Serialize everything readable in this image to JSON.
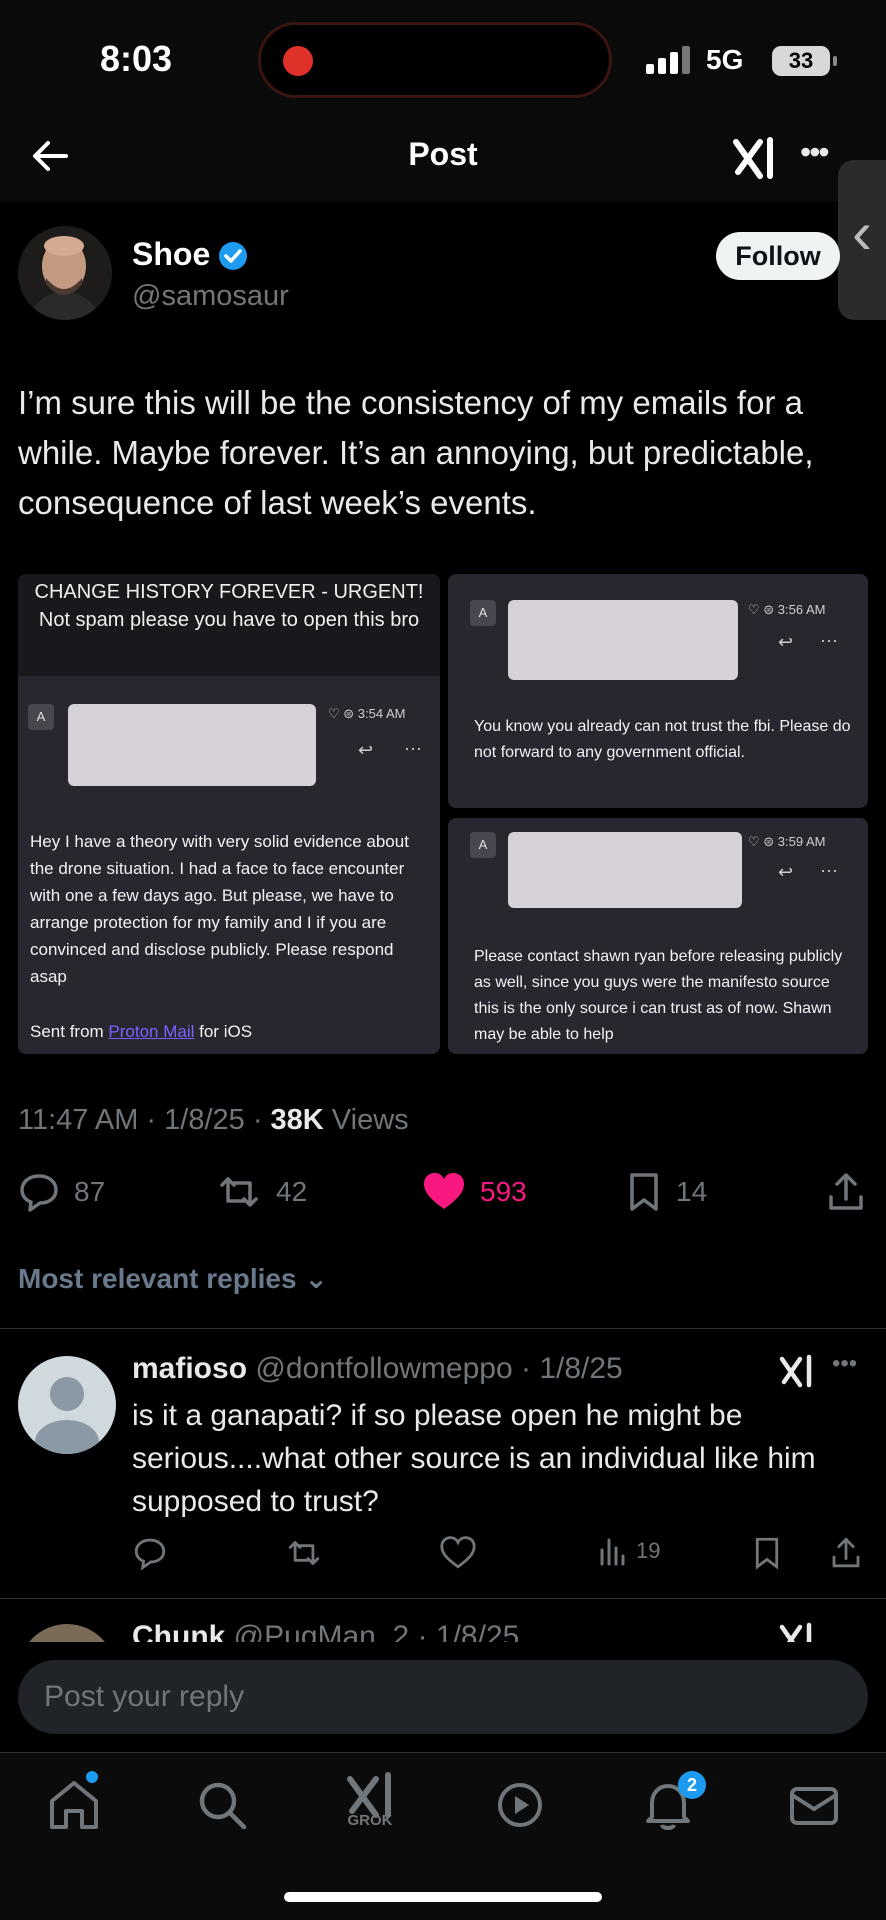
{
  "status_bar": {
    "time": "8:03",
    "network": "5G",
    "battery": "33"
  },
  "nav": {
    "title": "Post"
  },
  "post": {
    "author_name": "Shoe",
    "author_handle": "@samosaur",
    "follow_label": "Follow",
    "text": "I’m sure this will be the consistency of my emails for a while. Maybe forever. It’s an annoying, but predictable, consequence of last week’s events.",
    "timestamp": "11:47 AM · 1/8/25 · ",
    "views_count": "38K",
    "views_label": " Views",
    "replies": "87",
    "reposts": "42",
    "likes": "593",
    "bookmarks": "14"
  },
  "media": {
    "left": {
      "subject": "CHANGE HISTORY FOREVER - URGENT! Not spam please you have to open this bro",
      "badge": "A",
      "time": "3:54 AM",
      "body": "Hey I have a theory with very solid evidence about the drone situation. I had a face to face encounter with one a few days ago. But please, we have to arrange protection for my family and I if you are convinced and disclose publicly. Please respond asap",
      "sig_prefix": "Sent from ",
      "sig_link": "Proton Mail",
      "sig_suffix": " for iOS"
    },
    "top_right": {
      "badge": "A",
      "time": "3:56 AM",
      "body": "You know you already can not trust the fbi. Please do not forward to any government official."
    },
    "bottom_right": {
      "badge": "A",
      "time": "3:59 AM",
      "body": "Please contact shawn ryan before releasing publicly as well, since you guys were the manifesto source this is the only source i can trust as of now. Shawn may be able to help"
    }
  },
  "replies_section": {
    "sort_label": "Most relevant replies"
  },
  "reply_1": {
    "name": "mafioso",
    "handle": "@dontfollowmeppo",
    "date": "· 1/8/25",
    "text": "is it a ganapati? if so please open he might be serious....what other source is an individual like him supposed to trust?",
    "views": "19"
  },
  "reply_2": {
    "name": "Chunk",
    "handle": "@PugMan_2",
    "date": "· 1/8/25"
  },
  "composer": {
    "placeholder": "Post your reply"
  },
  "tabbar": {
    "grok_label": "GROK",
    "notifications_badge": "2"
  },
  "colors": {
    "like": "#f91880",
    "verified": "#1d9bf0",
    "muted": "#71767b"
  }
}
